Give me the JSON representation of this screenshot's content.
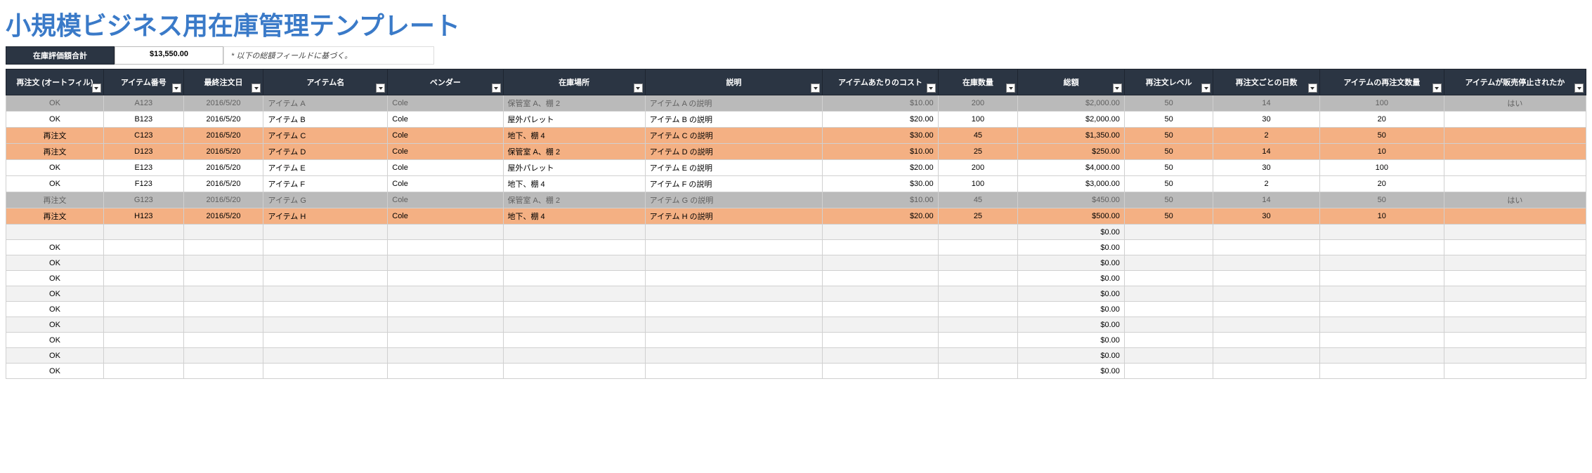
{
  "title": "小規模ビジネス用在庫管理テンプレート",
  "summary": {
    "label": "在庫評価額合計",
    "value": "$13,550.00",
    "note": "* 以下の総額フィールドに基づく。"
  },
  "headers": [
    "再注文 (オートフィル)",
    "アイテム番号",
    "最終注文日",
    "アイテム名",
    "ベンダー",
    "在庫場所",
    "説明",
    "アイテムあたりのコスト",
    "在庫数量",
    "総額",
    "再注文レベル",
    "再注文ごとの日数",
    "アイテムの再注文数量",
    "アイテムが販売停止されたか"
  ],
  "rows": [
    {
      "state": "gray",
      "cells": [
        "OK",
        "A123",
        "2016/5/20",
        "アイテム A",
        "Cole",
        "保管室 A、棚 2",
        "アイテム A の説明",
        "$10.00",
        "200",
        "$2,000.00",
        "50",
        "14",
        "100",
        "はい"
      ]
    },
    {
      "state": "plain",
      "cells": [
        "OK",
        "B123",
        "2016/5/20",
        "アイテム B",
        "Cole",
        "屋外パレット",
        "アイテム B の説明",
        "$20.00",
        "100",
        "$2,000.00",
        "50",
        "30",
        "20",
        ""
      ]
    },
    {
      "state": "orange",
      "cells": [
        "再注文",
        "C123",
        "2016/5/20",
        "アイテム C",
        "Cole",
        "地下、棚 4",
        "アイテム C の説明",
        "$30.00",
        "45",
        "$1,350.00",
        "50",
        "2",
        "50",
        ""
      ]
    },
    {
      "state": "orange",
      "cells": [
        "再注文",
        "D123",
        "2016/5/20",
        "アイテム D",
        "Cole",
        "保管室 A、棚 2",
        "アイテム D の説明",
        "$10.00",
        "25",
        "$250.00",
        "50",
        "14",
        "10",
        ""
      ]
    },
    {
      "state": "plain",
      "cells": [
        "OK",
        "E123",
        "2016/5/20",
        "アイテム E",
        "Cole",
        "屋外パレット",
        "アイテム E の説明",
        "$20.00",
        "200",
        "$4,000.00",
        "50",
        "30",
        "100",
        ""
      ]
    },
    {
      "state": "plain",
      "cells": [
        "OK",
        "F123",
        "2016/5/20",
        "アイテム F",
        "Cole",
        "地下、棚 4",
        "アイテム F の説明",
        "$30.00",
        "100",
        "$3,000.00",
        "50",
        "2",
        "20",
        ""
      ]
    },
    {
      "state": "gray",
      "cells": [
        "再注文",
        "G123",
        "2016/5/20",
        "アイテム G",
        "Cole",
        "保管室 A、棚 2",
        "アイテム G の説明",
        "$10.00",
        "45",
        "$450.00",
        "50",
        "14",
        "50",
        "はい"
      ]
    },
    {
      "state": "orange",
      "cells": [
        "再注文",
        "H123",
        "2016/5/20",
        "アイテム H",
        "Cole",
        "地下、棚 4",
        "アイテム H の説明",
        "$20.00",
        "25",
        "$500.00",
        "50",
        "30",
        "10",
        ""
      ]
    },
    {
      "state": "band0",
      "cells": [
        "",
        "",
        "",
        "",
        "",
        "",
        "",
        "",
        "",
        "$0.00",
        "",
        "",
        "",
        ""
      ]
    },
    {
      "state": "band1",
      "cells": [
        "OK",
        "",
        "",
        "",
        "",
        "",
        "",
        "",
        "",
        "$0.00",
        "",
        "",
        "",
        ""
      ]
    },
    {
      "state": "band0",
      "cells": [
        "OK",
        "",
        "",
        "",
        "",
        "",
        "",
        "",
        "",
        "$0.00",
        "",
        "",
        "",
        ""
      ]
    },
    {
      "state": "band1",
      "cells": [
        "OK",
        "",
        "",
        "",
        "",
        "",
        "",
        "",
        "",
        "$0.00",
        "",
        "",
        "",
        ""
      ]
    },
    {
      "state": "band0",
      "cells": [
        "OK",
        "",
        "",
        "",
        "",
        "",
        "",
        "",
        "",
        "$0.00",
        "",
        "",
        "",
        ""
      ]
    },
    {
      "state": "band1",
      "cells": [
        "OK",
        "",
        "",
        "",
        "",
        "",
        "",
        "",
        "",
        "$0.00",
        "",
        "",
        "",
        ""
      ]
    },
    {
      "state": "band0",
      "cells": [
        "OK",
        "",
        "",
        "",
        "",
        "",
        "",
        "",
        "",
        "$0.00",
        "",
        "",
        "",
        ""
      ]
    },
    {
      "state": "band1",
      "cells": [
        "OK",
        "",
        "",
        "",
        "",
        "",
        "",
        "",
        "",
        "$0.00",
        "",
        "",
        "",
        ""
      ]
    },
    {
      "state": "band0",
      "cells": [
        "OK",
        "",
        "",
        "",
        "",
        "",
        "",
        "",
        "",
        "$0.00",
        "",
        "",
        "",
        ""
      ]
    },
    {
      "state": "band1",
      "cells": [
        "OK",
        "",
        "",
        "",
        "",
        "",
        "",
        "",
        "",
        "$0.00",
        "",
        "",
        "",
        ""
      ]
    }
  ],
  "alignments": [
    "center",
    "center",
    "center",
    "left",
    "left",
    "left",
    "left",
    "right",
    "center",
    "right",
    "center",
    "center",
    "center",
    "center"
  ]
}
